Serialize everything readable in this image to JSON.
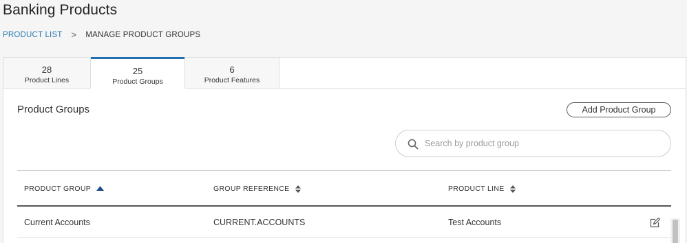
{
  "header": {
    "title": "Banking Products"
  },
  "breadcrumb": {
    "link": "PRODUCT LIST",
    "separator": ">",
    "current": "MANAGE PRODUCT GROUPS"
  },
  "tabs": [
    {
      "count": "28",
      "label": "Product Lines"
    },
    {
      "count": "25",
      "label": "Product Groups"
    },
    {
      "count": "6",
      "label": "Product Features"
    }
  ],
  "section": {
    "title": "Product Groups",
    "add_button": "Add Product Group"
  },
  "search": {
    "placeholder": "Search by product group",
    "value": ""
  },
  "table": {
    "columns": [
      "PRODUCT GROUP",
      "GROUP REFERENCE",
      "PRODUCT LINE"
    ],
    "rows": [
      {
        "product_group": "Current Accounts",
        "group_reference": "CURRENT.ACCOUNTS",
        "product_line": "Test Accounts"
      }
    ]
  },
  "colors": {
    "accent": "#1f6fb2",
    "link": "#2b7bb0"
  },
  "icons": {
    "search": "search-icon",
    "edit": "edit-icon",
    "sort_asc": "sort-asc-icon",
    "sort_both": "sort-both-icon"
  }
}
